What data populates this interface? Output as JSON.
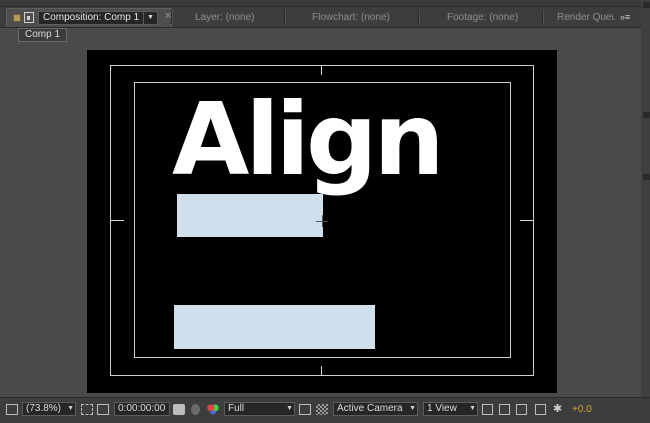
{
  "tabs": {
    "active_label": "Composition: Comp 1",
    "layer": "Layer: (none)",
    "flowchart": "Flowchart: (none)",
    "footage": "Footage: (none)",
    "render_queue": "Render Queu"
  },
  "subbar": {
    "comp_button": "Comp 1"
  },
  "viewer": {
    "text": "Align"
  },
  "toolbar": {
    "magnification": "(73.8%)",
    "timecode": "0:00:00:00",
    "resolution": "Full",
    "camera": "Active Camera",
    "view_layout": "1 View",
    "exposure": "+0.0"
  },
  "colors": {
    "panel_bg": "#4a4a4a",
    "canvas": "#000000",
    "solid_fill": "#cfdfec",
    "exposure_text": "#d9a62a"
  }
}
